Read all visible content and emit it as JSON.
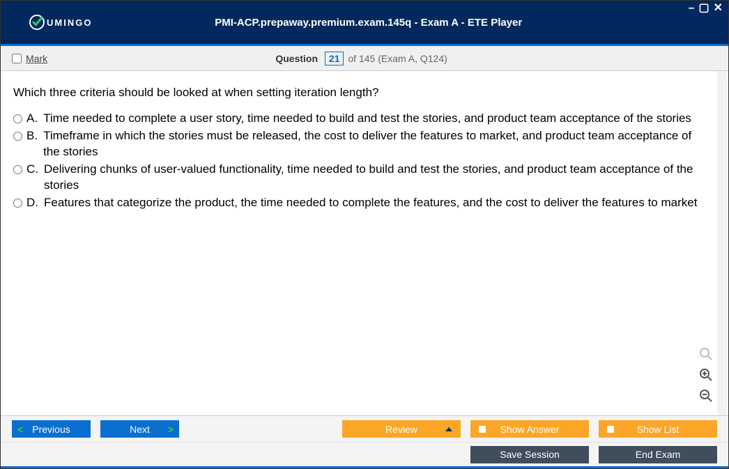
{
  "titlebar": {
    "brand": "UMINGO",
    "title": "PMI-ACP.prepaway.premium.exam.145q - Exam A - ETE Player"
  },
  "header": {
    "mark_label": "Mark",
    "question_label": "Question",
    "question_number": "21",
    "of_text": "of 145 (Exam A, Q124)"
  },
  "question": {
    "text": "Which three criteria should be looked at when setting iteration length?",
    "options": [
      {
        "letter": "A.",
        "text": "Time needed to complete a user story, time needed to build and test the stories, and product team acceptance of the stories"
      },
      {
        "letter": "B.",
        "text": "Timeframe in which the stories must be released, the cost to deliver the features to market, and product team acceptance of the stories"
      },
      {
        "letter": "C.",
        "text": "Delivering chunks of user-valued functionality, time needed to build and test the stories, and product team acceptance of the stories"
      },
      {
        "letter": "D.",
        "text": "Features that categorize the product, the time needed to complete the features, and the cost to deliver the features to market"
      }
    ]
  },
  "toolbar": {
    "previous": "Previous",
    "next": "Next",
    "review": "Review",
    "show_answer": "Show Answer",
    "show_list": "Show List",
    "save_session": "Save Session",
    "end_exam": "End Exam"
  }
}
